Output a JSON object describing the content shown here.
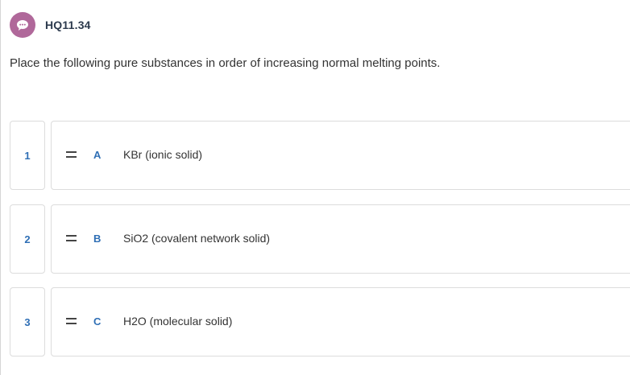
{
  "header": {
    "question_id": "HQ11.34",
    "avatar_icon": "chat-bubble-icon",
    "avatar_color": "#b0689a"
  },
  "prompt": "Place the following pure substances in order of increasing normal melting points.",
  "items": [
    {
      "position": "1",
      "letter": "A",
      "text": "KBr (ionic solid)"
    },
    {
      "position": "2",
      "letter": "B",
      "text": "SiO2 (covalent network solid)"
    },
    {
      "position": "3",
      "letter": "C",
      "text": "H2O (molecular solid)"
    }
  ],
  "colors": {
    "accent": "#2f6fb5",
    "border": "#dcdcdc",
    "title": "#2d3b4e"
  }
}
